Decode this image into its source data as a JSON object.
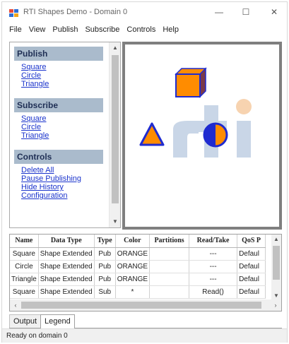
{
  "window": {
    "title": "RTI Shapes Demo - Domain 0",
    "minimize": "—",
    "maximize": "☐",
    "close": "✕"
  },
  "menu": [
    "File",
    "View",
    "Publish",
    "Subscribe",
    "Controls",
    "Help"
  ],
  "left_panel": {
    "publish": {
      "heading": "Publish",
      "links": [
        "Square",
        "Circle",
        "Triangle"
      ]
    },
    "subscribe": {
      "heading": "Subscribe",
      "links": [
        "Square",
        "Circle",
        "Triangle"
      ]
    },
    "controls": {
      "heading": "Controls",
      "links": [
        "Delete All",
        "Pause Publishing",
        "Hide History",
        "Configuration"
      ]
    }
  },
  "canvas": {
    "watermark": "rti",
    "shapes": [
      {
        "kind": "cube",
        "color": "#ff8c00"
      },
      {
        "kind": "triangle",
        "color": "#ff8c00"
      },
      {
        "kind": "circle",
        "color": "#ff8c00"
      }
    ],
    "colors": {
      "fill": "#ff8c00",
      "outline": "#1f2bd0",
      "cube_side": "#7a3a4a",
      "watermark_blue": "#c9d6e7",
      "watermark_dot": "#f7d3b0"
    }
  },
  "table": {
    "columns": [
      "Name",
      "Data Type",
      "Type",
      "Color",
      "Partitions",
      "Read/Take",
      "QoS P"
    ],
    "rows": [
      [
        "Square",
        "Shape Extended",
        "Pub",
        "ORANGE",
        "",
        "---",
        "Defaul"
      ],
      [
        "Circle",
        "Shape Extended",
        "Pub",
        "ORANGE",
        "",
        "---",
        "Defaul"
      ],
      [
        "Triangle",
        "Shape Extended",
        "Pub",
        "ORANGE",
        "",
        "---",
        "Defaul"
      ],
      [
        "Square",
        "Shape Extended",
        "Sub",
        "*",
        "",
        "Read()",
        "Defaul"
      ]
    ]
  },
  "tabs": [
    "Output",
    "Legend"
  ],
  "active_tab": "Legend",
  "status": "Ready on domain 0"
}
